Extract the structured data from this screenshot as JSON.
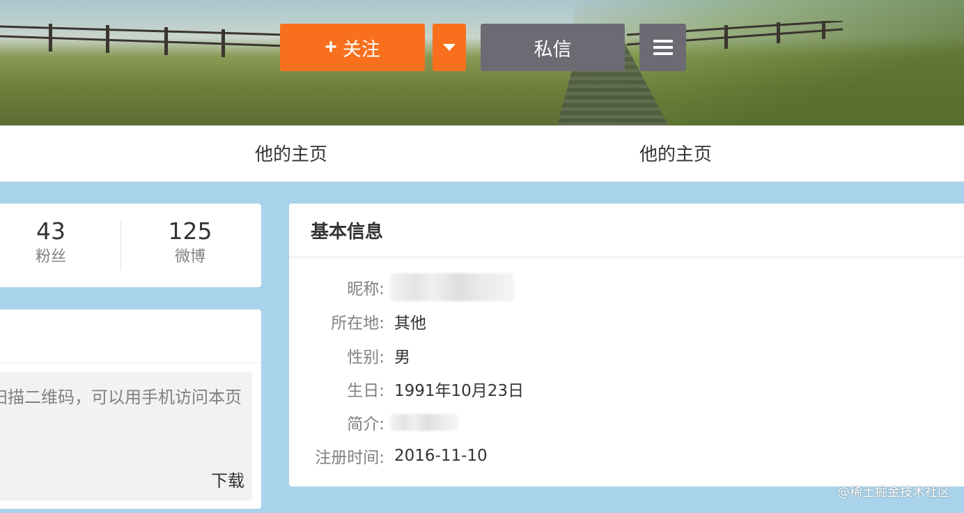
{
  "header": {
    "follow_label": "关注",
    "follow_icon": "plus-icon",
    "dropdown_icon": "caret-down-icon",
    "message_label": "私信",
    "menu_icon": "hamburger-menu-icon"
  },
  "nav": {
    "tabs": [
      {
        "label": "他的主页"
      },
      {
        "label": "他的主页"
      }
    ]
  },
  "stats": {
    "items": [
      {
        "value": "43",
        "label": "粉丝"
      },
      {
        "value": "125",
        "label": "微博"
      }
    ]
  },
  "qr_card": {
    "text": "扫描二维码，可以用手机访问本页",
    "download_label": "下载"
  },
  "basic_info": {
    "title": "基本信息",
    "rows": [
      {
        "label": "昵称:",
        "value": "",
        "blurred": true
      },
      {
        "label": "所在地:",
        "value": "其他"
      },
      {
        "label": "性别:",
        "value": "男"
      },
      {
        "label": "生日:",
        "value": "1991年10月23日"
      },
      {
        "label": "简介:",
        "value": "",
        "blurred": true
      },
      {
        "label": "注册时间:",
        "value": "2016-11-10"
      }
    ]
  },
  "watermark": "@稀土掘金技术社区",
  "colors": {
    "accent_orange": "#f8701d",
    "button_gray": "#6d6a73",
    "page_background": "#a9d3ea"
  }
}
